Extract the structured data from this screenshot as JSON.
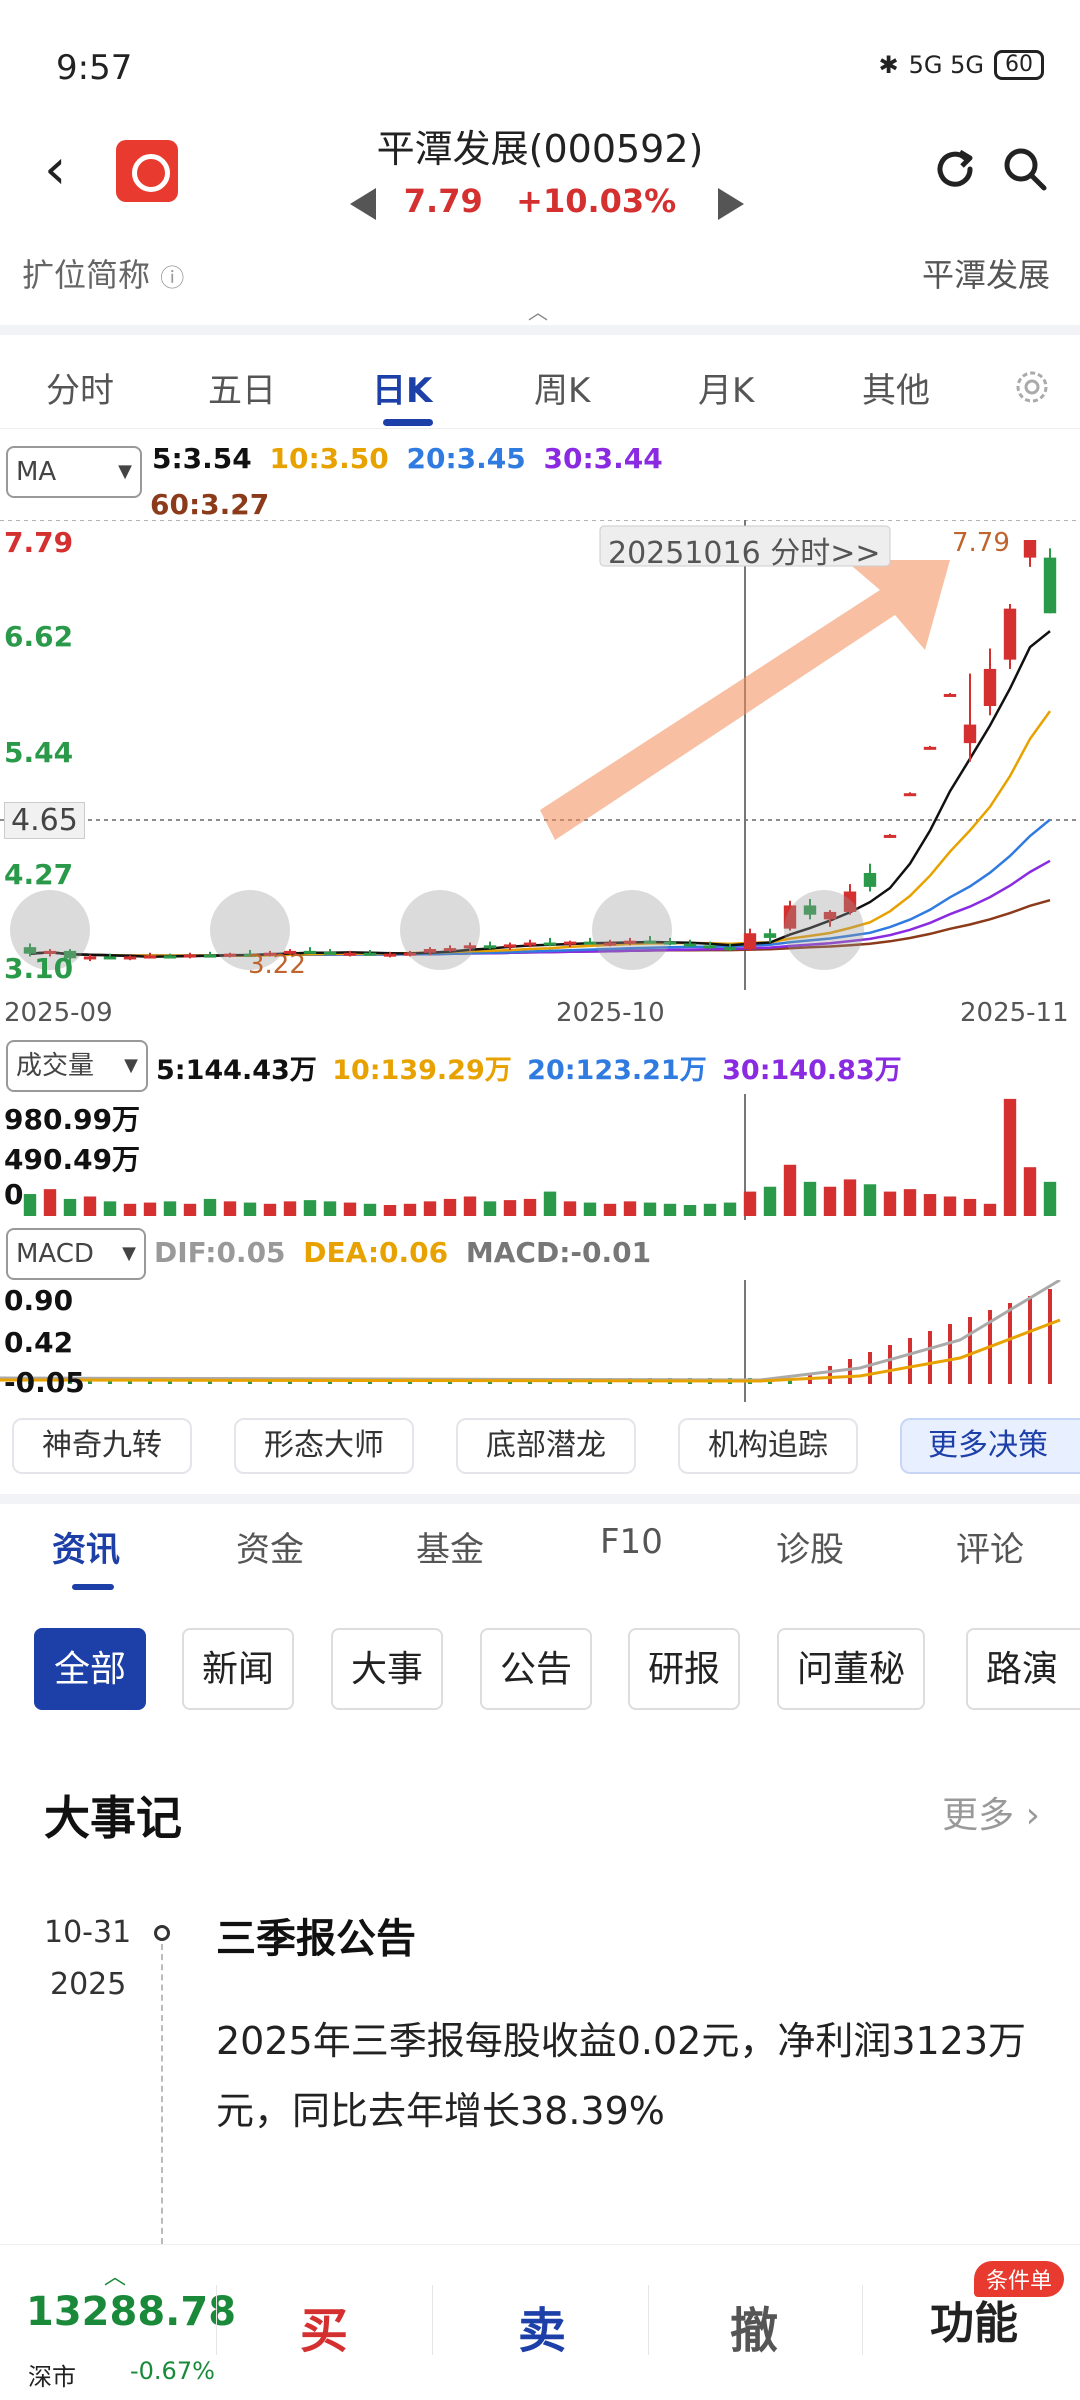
{
  "status": {
    "time": "9:57",
    "signal": "5G 5G",
    "battery": "60"
  },
  "header": {
    "name": "平潭发展(000592)",
    "price": "7.79",
    "change": "+10.03%",
    "sub_left": "扩位简称",
    "sub_right": "平潭发展"
  },
  "chart_tabs": [
    "分时",
    "五日",
    "日K",
    "周K",
    "月K",
    "其他"
  ],
  "ma": {
    "select": "MA",
    "ma5": "5:3.54",
    "ma10": "10:3.50",
    "ma20": "20:3.45",
    "ma30": "30:3.44",
    "ma60": "60:3.27"
  },
  "price_axis": {
    "high": "7.79",
    "p662": "6.62",
    "p544": "5.44",
    "cur": "4.65",
    "p427": "4.27",
    "low": "3.10",
    "min_marker": "3.22",
    "max_marker": "7.79"
  },
  "crosshair_label": "20251016 分时>>",
  "dates": [
    "2025-09",
    "2025-10",
    "2025-11"
  ],
  "volume": {
    "select": "成交量",
    "v5": "5:144.43万",
    "v10": "10:139.29万",
    "v20": "20:123.21万",
    "v30": "30:140.83万",
    "axis_hi": "980.99万",
    "axis_mid": "490.49万",
    "axis_zero": "0"
  },
  "macd": {
    "select": "MACD",
    "dif": "DIF:0.05",
    "dea": "DEA:0.06",
    "macd": "MACD:-0.01",
    "axis_hi": "0.90",
    "axis_mid": "0.42",
    "axis_lo": "-0.05"
  },
  "strategy_pills": [
    "神奇九转",
    "形态大师",
    "底部潜龙",
    "机构追踪",
    "更多决策"
  ],
  "info_tabs": [
    "资讯",
    "资金",
    "基金",
    "F10",
    "诊股",
    "评论"
  ],
  "chips": [
    "全部",
    "新闻",
    "大事",
    "公告",
    "研报",
    "问董秘",
    "路演"
  ],
  "events": {
    "title": "大事记",
    "more": "更多",
    "item": {
      "date": "10-31",
      "year": "2025",
      "title": "三季报公告",
      "desc": "2025年三季报每股收益0.02元，净利润3123万元，同比去年增长38.39%"
    }
  },
  "bottom": {
    "index_value": "13288.78",
    "index_name": "深市",
    "index_pct": "-0.67%",
    "buy": "买",
    "sell": "卖",
    "cancel": "撤",
    "func": "功能",
    "badge": "条件单"
  },
  "colors": {
    "up": "#d43030",
    "down": "#2a9a4a",
    "accent": "#1d3fa8",
    "ma5": "#111111",
    "ma10": "#e8a200",
    "ma20": "#2f7be0",
    "ma30": "#8a2be2",
    "ma60": "#8b3a1a"
  },
  "chart_data": {
    "type": "candlestick",
    "candles": [
      {
        "o": 3.4,
        "h": 3.44,
        "l": 3.3,
        "c": 3.33
      },
      {
        "o": 3.33,
        "h": 3.38,
        "l": 3.3,
        "c": 3.36
      },
      {
        "o": 3.36,
        "h": 3.38,
        "l": 3.22,
        "c": 3.28
      },
      {
        "o": 3.28,
        "h": 3.32,
        "l": 3.25,
        "c": 3.3
      },
      {
        "o": 3.3,
        "h": 3.33,
        "l": 3.27,
        "c": 3.29
      },
      {
        "o": 3.29,
        "h": 3.31,
        "l": 3.26,
        "c": 3.3
      },
      {
        "o": 3.3,
        "h": 3.34,
        "l": 3.28,
        "c": 3.31
      },
      {
        "o": 3.31,
        "h": 3.33,
        "l": 3.29,
        "c": 3.3
      },
      {
        "o": 3.3,
        "h": 3.34,
        "l": 3.28,
        "c": 3.32
      },
      {
        "o": 3.32,
        "h": 3.35,
        "l": 3.3,
        "c": 3.31
      },
      {
        "o": 3.31,
        "h": 3.34,
        "l": 3.29,
        "c": 3.33
      },
      {
        "o": 3.33,
        "h": 3.37,
        "l": 3.31,
        "c": 3.32
      },
      {
        "o": 3.32,
        "h": 3.36,
        "l": 3.3,
        "c": 3.34
      },
      {
        "o": 3.34,
        "h": 3.38,
        "l": 3.32,
        "c": 3.36
      },
      {
        "o": 3.36,
        "h": 3.4,
        "l": 3.33,
        "c": 3.35
      },
      {
        "o": 3.35,
        "h": 3.38,
        "l": 3.32,
        "c": 3.33
      },
      {
        "o": 3.33,
        "h": 3.36,
        "l": 3.3,
        "c": 3.34
      },
      {
        "o": 3.34,
        "h": 3.37,
        "l": 3.31,
        "c": 3.32
      },
      {
        "o": 3.32,
        "h": 3.35,
        "l": 3.29,
        "c": 3.33
      },
      {
        "o": 3.33,
        "h": 3.36,
        "l": 3.3,
        "c": 3.34
      },
      {
        "o": 3.34,
        "h": 3.4,
        "l": 3.31,
        "c": 3.38
      },
      {
        "o": 3.38,
        "h": 3.42,
        "l": 3.35,
        "c": 3.39
      },
      {
        "o": 3.39,
        "h": 3.45,
        "l": 3.36,
        "c": 3.42
      },
      {
        "o": 3.42,
        "h": 3.46,
        "l": 3.38,
        "c": 3.4
      },
      {
        "o": 3.4,
        "h": 3.45,
        "l": 3.37,
        "c": 3.43
      },
      {
        "o": 3.43,
        "h": 3.48,
        "l": 3.4,
        "c": 3.45
      },
      {
        "o": 3.45,
        "h": 3.5,
        "l": 3.41,
        "c": 3.43
      },
      {
        "o": 3.43,
        "h": 3.47,
        "l": 3.4,
        "c": 3.46
      },
      {
        "o": 3.46,
        "h": 3.5,
        "l": 3.43,
        "c": 3.44
      },
      {
        "o": 3.44,
        "h": 3.48,
        "l": 3.41,
        "c": 3.45
      },
      {
        "o": 3.45,
        "h": 3.5,
        "l": 3.42,
        "c": 3.47
      },
      {
        "o": 3.47,
        "h": 3.52,
        "l": 3.44,
        "c": 3.46
      },
      {
        "o": 3.46,
        "h": 3.5,
        "l": 3.42,
        "c": 3.44
      },
      {
        "o": 3.44,
        "h": 3.48,
        "l": 3.4,
        "c": 3.42
      },
      {
        "o": 3.42,
        "h": 3.46,
        "l": 3.38,
        "c": 3.4
      },
      {
        "o": 3.4,
        "h": 3.44,
        "l": 3.36,
        "c": 3.38
      },
      {
        "o": 3.38,
        "h": 3.6,
        "l": 3.36,
        "c": 3.55
      },
      {
        "o": 3.55,
        "h": 3.6,
        "l": 3.45,
        "c": 3.5
      },
      {
        "o": 3.6,
        "h": 3.9,
        "l": 3.58,
        "c": 3.85
      },
      {
        "o": 3.85,
        "h": 3.92,
        "l": 3.7,
        "c": 3.75
      },
      {
        "o": 3.7,
        "h": 3.8,
        "l": 3.62,
        "c": 3.78
      },
      {
        "o": 3.78,
        "h": 4.08,
        "l": 3.75,
        "c": 4.0
      },
      {
        "o": 4.2,
        "h": 4.3,
        "l": 4.0,
        "c": 4.05
      },
      {
        "o": 4.6,
        "h": 4.62,
        "l": 4.58,
        "c": 4.61
      },
      {
        "o": 5.05,
        "h": 5.07,
        "l": 5.03,
        "c": 5.06
      },
      {
        "o": 5.55,
        "h": 5.57,
        "l": 5.53,
        "c": 5.56
      },
      {
        "o": 6.12,
        "h": 6.14,
        "l": 6.1,
        "c": 6.13
      },
      {
        "o": 5.6,
        "h": 6.35,
        "l": 5.4,
        "c": 5.8
      },
      {
        "o": 6.0,
        "h": 6.62,
        "l": 5.9,
        "c": 6.4
      },
      {
        "o": 6.5,
        "h": 7.1,
        "l": 6.4,
        "c": 7.05
      },
      {
        "o": 7.6,
        "h": 7.79,
        "l": 7.5,
        "c": 7.79
      },
      {
        "o": 7.6,
        "h": 7.7,
        "l": 7.0,
        "c": 7.0
      }
    ],
    "ylim": [
      3.1,
      7.79
    ]
  }
}
